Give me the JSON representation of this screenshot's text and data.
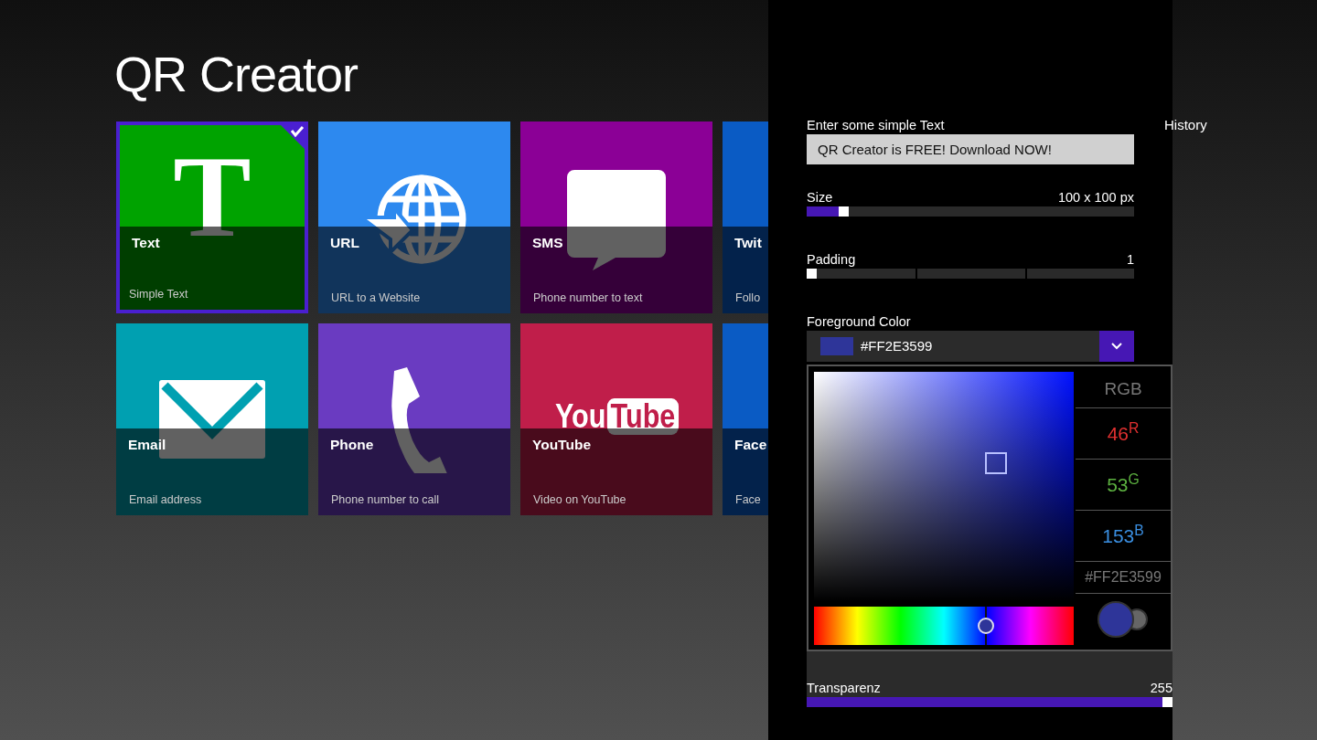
{
  "app_title": "QR Creator",
  "tiles": [
    {
      "title": "Text",
      "subtitle": "Simple Text",
      "color": "#00a300",
      "kind": "letter",
      "icon_text": "T",
      "selected": true
    },
    {
      "title": "URL",
      "subtitle": "URL to a Website",
      "color": "#2d89ef",
      "kind": "globe",
      "selected": false
    },
    {
      "title": "SMS",
      "subtitle": "Phone number to text",
      "color": "#8b0096",
      "kind": "speech",
      "selected": false
    },
    {
      "title": "Twit",
      "subtitle": "Follo",
      "color": "#0a5bc4",
      "kind": "blank",
      "selected": false
    },
    {
      "title": "Email",
      "subtitle": "Email address",
      "color": "#00a0b1",
      "kind": "mail",
      "selected": false
    },
    {
      "title": "Phone",
      "subtitle": "Phone number to call",
      "color": "#6a3bc1",
      "kind": "phone",
      "selected": false
    },
    {
      "title": "YouTube",
      "subtitle": "Video on YouTube",
      "color": "#c01e4a",
      "kind": "youtube",
      "logo_words": [
        "You",
        "Tube"
      ],
      "selected": false
    },
    {
      "title": "Face",
      "subtitle": "Face",
      "color": "#0a5bc4",
      "kind": "blank",
      "selected": false
    }
  ],
  "panel": {
    "text_label": "Enter some simple Text",
    "text_value": "QR Creator is FREE! Download NOW!",
    "size": {
      "label": "Size",
      "reading": "100 x 100 px",
      "level": 0.1
    },
    "padding": {
      "label": "Padding",
      "reading": "1",
      "level": 0
    },
    "foreground": {
      "label": "Foreground Color",
      "hex": "#FF2E3599",
      "expanded": true
    },
    "picker": {
      "hue": {
        "level": 0.66
      },
      "mode": "RGB",
      "r": "46$^{R}$",
      "g": "53$^{G}$",
      "b": "153$^{B}$",
      "hex": "#FF2E3599"
    },
    "transparency": {
      "label": "Transparenz",
      "reading": "255",
      "level": 1
    }
  },
  "history_label": "History"
}
